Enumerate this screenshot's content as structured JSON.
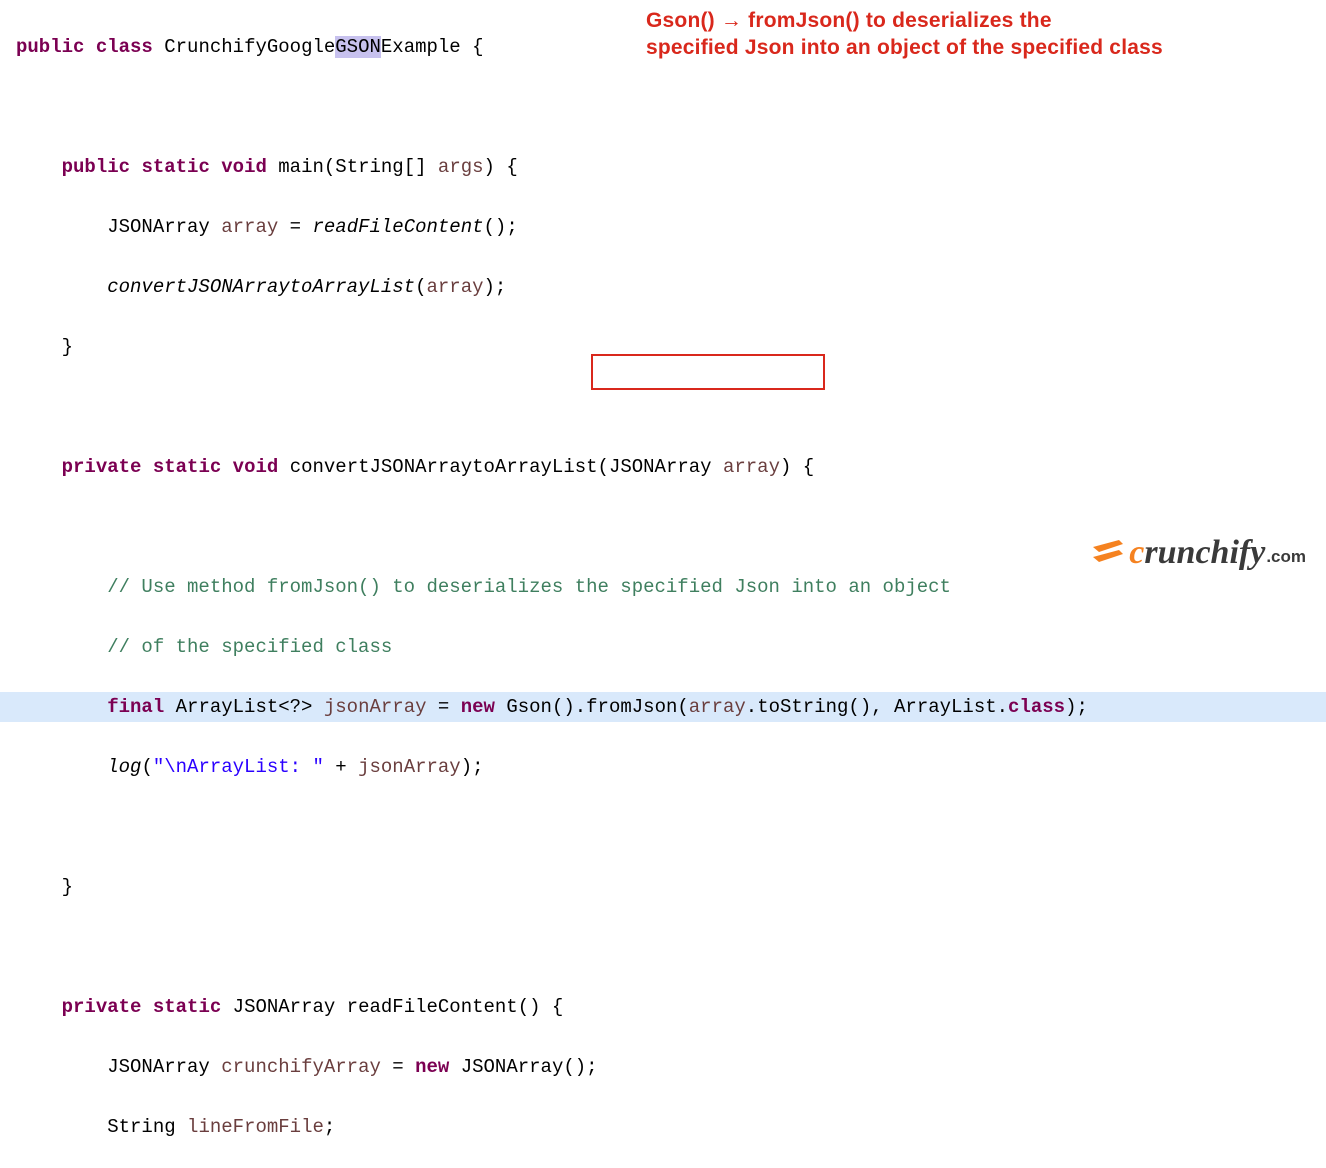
{
  "annotation": {
    "line1": "Gson() → fromJson() to deserializes the",
    "line2": "specified Json into an object of the specified class"
  },
  "code": {
    "l1_public": "public",
    "l1_class": "class",
    "l1_name_a": "CrunchifyGoogle",
    "l1_sel": "GSON",
    "l1_name_b": "Example {",
    "l3_public": "public",
    "l3_static": "static",
    "l3_void": "void",
    "l3_rest": "main(String[] ",
    "l3_var": "args",
    "l3_close": ") {",
    "l4_type": "JSONArray ",
    "l4_var": "array",
    "l4_eq": " = ",
    "l4_call": "readFileContent",
    "l4_end": "();",
    "l5_call": "convertJSONArraytoArrayList",
    "l5_open": "(",
    "l5_var": "array",
    "l5_end": ");",
    "l6": "}",
    "l8_private": "private",
    "l8_static": "static",
    "l8_void": "void",
    "l8_name": "convertJSONArraytoArrayList(JSONArray ",
    "l8_var": "array",
    "l8_close": ") {",
    "l10": "// Use method fromJson() to deserializes the specified Json into an object",
    "l11": "// of the specified class",
    "l12_final": "final",
    "l12_type": " ArrayList<?> ",
    "l12_var": "jsonArray",
    "l12_eq": " = ",
    "l12_new": "new",
    "l12_gson": " Gson().fromJson(",
    "l12_arg": "array",
    "l12_mid": ".toString(), ArrayList.",
    "l12_classkw": "class",
    "l12_end": ");",
    "l13_log": "log",
    "l13_open": "(",
    "l13_str": "\"\\nArrayList: \"",
    "l13_plus": " + ",
    "l13_var": "jsonArray",
    "l13_end": ");",
    "l15": "}",
    "l17_private": "private",
    "l17_static": "static",
    "l17_ret": " JSONArray readFileContent() {",
    "l18_type": "JSONArray ",
    "l18_var": "crunchifyArray",
    "l18_eq": " = ",
    "l18_new": "new",
    "l18_rest": " JSONArray();",
    "l19_type": "String ",
    "l19_var": "lineFromFile",
    "l19_end": ";"
  },
  "logo": {
    "brand_c": "c",
    "brand_rest": "runchify",
    "tld": ".com"
  }
}
